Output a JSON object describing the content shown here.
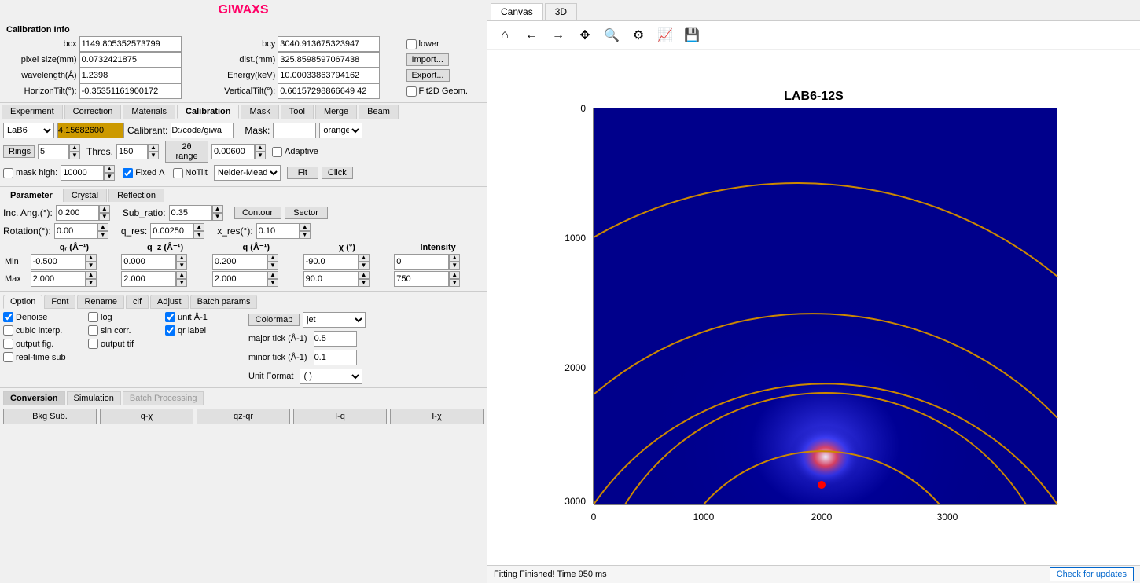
{
  "app": {
    "title": "GIWAXS"
  },
  "calib_info": {
    "label": "Calibration Info",
    "bcx_label": "bcx",
    "bcx_value": "1149.805352573799",
    "bcy_label": "bcy",
    "bcy_value": "3040.913675323947",
    "lower_label": "lower",
    "pixel_size_label": "pixel size(mm)",
    "pixel_size_value": "0.0732421875",
    "dist_label": "dist.(mm)",
    "dist_value": "325.8598597067438",
    "import_label": "Import...",
    "wavelength_label": "wavelength(Å)",
    "wavelength_value": "1.2398",
    "energy_label": "Energy(keV)",
    "energy_value": "10.00033863794162",
    "export_label": "Export...",
    "horizon_tilt_label": "HorizonTilt(°):",
    "horizon_tilt_value": "-0.35351161900172",
    "vertical_tilt_label": "VerticalTilt(°):",
    "vertical_tilt_value": "0.66157298866649 42",
    "fit2d_label": "Fit2D Geom."
  },
  "main_tabs": {
    "items": [
      "Experiment",
      "Correction",
      "Materials",
      "Calibration",
      "Mask",
      "Tool",
      "Merge",
      "Beam"
    ]
  },
  "calibration_tab": {
    "lab6_value": "LaB6",
    "color_value": "4.15682600",
    "calibrant_label": "Calibrant:",
    "calibrant_path": "D:/code/giwa",
    "mask_label": "Mask:",
    "mask_color": "orange",
    "rings_label": "Rings",
    "rings_value": "5",
    "thres_label": "Thres.",
    "thres_value": "150",
    "range_label": "2θ range",
    "range_value": "0.00600",
    "adaptive_label": "Adaptive",
    "mask_high_label": "mask high:",
    "mask_high_value": "10000",
    "fixed_lambda_label": "Fixed Λ",
    "fixed_lambda_checked": true,
    "notilt_label": "NoTilt",
    "method_value": "Nelder-Mead",
    "fit_label": "Fit",
    "click_label": "Click"
  },
  "param_tabs": {
    "items": [
      "Parameter",
      "Crystal",
      "Reflection"
    ]
  },
  "parameter": {
    "inc_ang_label": "Inc. Ang.(°):",
    "inc_ang_value": "0.200",
    "sub_ratio_label": "Sub_ratio:",
    "sub_ratio_value": "0.35",
    "contour_label": "Contour",
    "sector_label": "Sector",
    "rotation_label": "Rotation(°):",
    "rotation_value": "0.00",
    "q_res_label": "q_res:",
    "q_res_value": "0.00250",
    "x_res_label": "x_res(°):",
    "x_res_value": "0.10",
    "col_headers": [
      "qᵣ (Å⁻¹)",
      "q_z (Å⁻¹)",
      "q (Å⁻¹)",
      "χ (°)",
      "Intensity"
    ],
    "row_min_label": "Min",
    "row_max_label": "Max",
    "qr_min": "-0.500",
    "qr_max": "2.000",
    "qz_min": "0.000",
    "qz_max": "2.000",
    "q_min": "0.200",
    "q_max": "2.000",
    "chi_min": "-90.0",
    "chi_max": "90.0",
    "int_min": "0",
    "int_max": "750"
  },
  "options_tabs": {
    "items": [
      "Option",
      "Font",
      "Rename",
      "cif",
      "Adjust",
      "Batch params"
    ]
  },
  "options": {
    "denoise_label": "Denoise",
    "denoise_checked": true,
    "log_label": "log",
    "log_checked": false,
    "unit_label": "unit Å-1",
    "unit_checked": true,
    "colormap_label": "Colormap",
    "colormap_value": "jet",
    "cubic_label": "cubic interp.",
    "cubic_checked": false,
    "sin_corr_label": "sin corr.",
    "sin_corr_checked": false,
    "qr_label": "qr label",
    "qr_checked": true,
    "major_tick_label": "major tick (Å-1)",
    "major_tick_value": "0.5",
    "output_fig_label": "output fig.",
    "output_fig_checked": false,
    "output_tif_label": "output tif",
    "output_tif_checked": false,
    "minor_tick_label": "minor tick (Å-1)",
    "minor_tick_value": "0.1",
    "realtime_label": "real-time sub",
    "realtime_checked": false,
    "unit_format_label": "Unit Format",
    "unit_format_value": "( )"
  },
  "conversion_tabs": {
    "items": [
      "Conversion",
      "Simulation",
      "Batch Processing"
    ]
  },
  "conversion_buttons": {
    "bkg_sub": "Bkg Sub.",
    "q_x": "q-χ",
    "qz_qr": "qz-qr",
    "i_q": "I-q",
    "i_x": "I-χ"
  },
  "canvas_tabs": {
    "items": [
      "Canvas",
      "3D"
    ],
    "active": "Canvas"
  },
  "plot": {
    "title": "LAB6-12S",
    "x_axis_labels": [
      "0",
      "1000",
      "2000",
      "3000"
    ],
    "y_axis_labels": [
      "0",
      "1000",
      "2000",
      "3000"
    ]
  },
  "status": {
    "message": "Fitting Finished! Time 950 ms",
    "check_updates_label": "Check for updates"
  },
  "toolbar": {
    "home_icon": "⌂",
    "back_icon": "←",
    "forward_icon": "→",
    "pan_icon": "✥",
    "zoom_icon": "🔍",
    "config_icon": "⚙",
    "plot_icon": "📈",
    "save_icon": "💾"
  }
}
